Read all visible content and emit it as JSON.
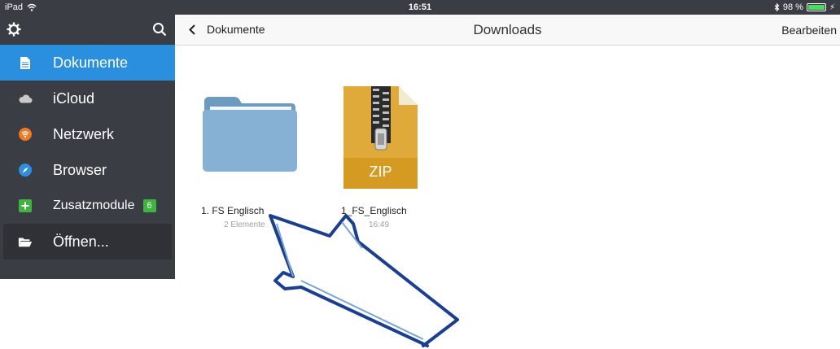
{
  "status": {
    "device": "iPad",
    "time": "16:51",
    "battery": "98 %",
    "battery_level": 0.98
  },
  "sidebar": {
    "items": [
      {
        "label": "Dokumente",
        "icon": "document-icon",
        "active": true
      },
      {
        "label": "iCloud",
        "icon": "cloud-icon"
      },
      {
        "label": "Netzwerk",
        "icon": "wifi-icon"
      },
      {
        "label": "Browser",
        "icon": "compass-icon"
      },
      {
        "label": "Zusatzmodule",
        "icon": "plus-icon",
        "badge": "6"
      },
      {
        "label": "Öffnen...",
        "icon": "folder-open-icon"
      }
    ]
  },
  "nav": {
    "back_label": "Dokumente",
    "title": "Downloads",
    "edit_label": "Bearbeiten"
  },
  "files": [
    {
      "name": "1. FS Englisch",
      "meta": "2 Elemente",
      "type": "folder"
    },
    {
      "name": "1_FS_Englisch",
      "meta": "16:49",
      "type": "zip",
      "badge": "ZIP"
    }
  ]
}
